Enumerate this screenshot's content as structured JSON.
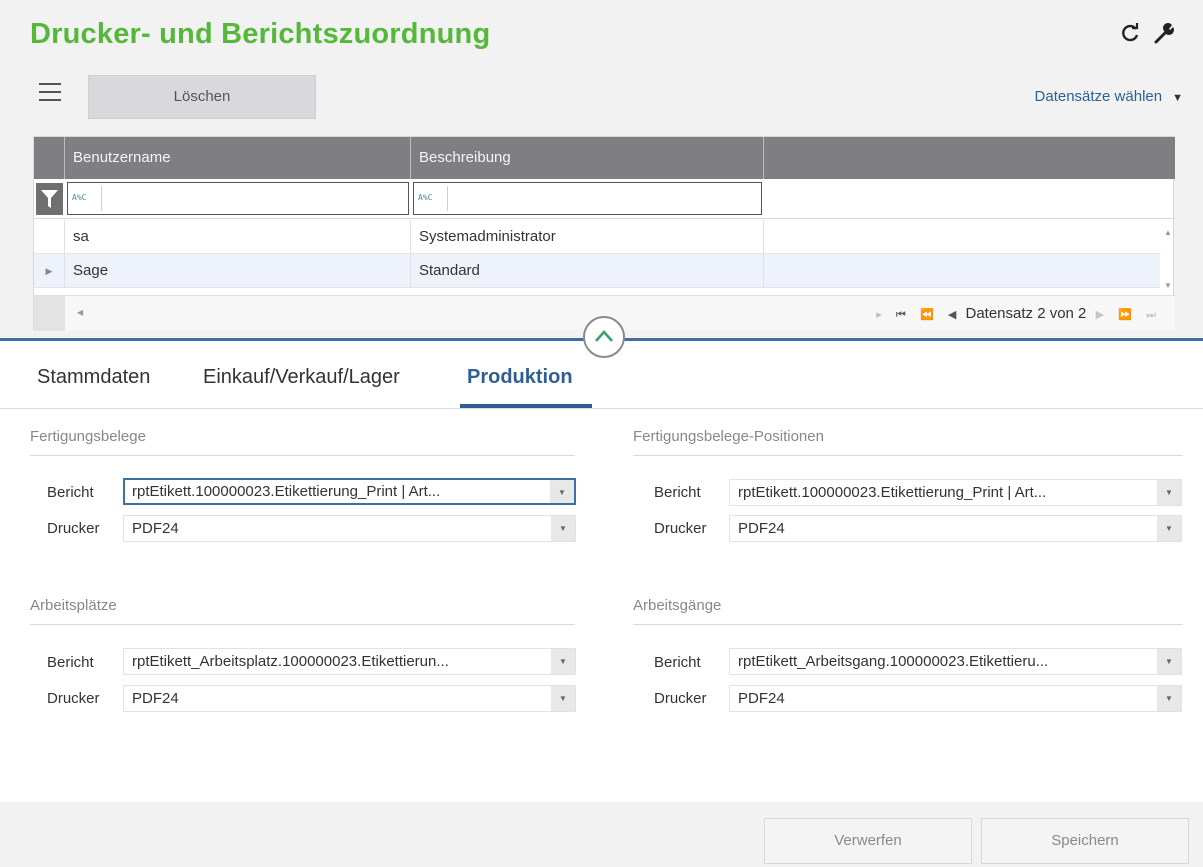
{
  "window": {
    "title": "Drucker- und Berichtszuordnung"
  },
  "toolbar": {
    "delete_label": "Löschen",
    "select_records_label": "Datensätze wählen",
    "refresh_icon": "refresh-icon",
    "settings_icon": "wrench-icon",
    "menu_icon": "hamburger-menu-icon"
  },
  "grid": {
    "columns": [
      "Benutzername",
      "Beschreibung",
      ""
    ],
    "filter_operator": "A%C",
    "rows": [
      {
        "user": "sa",
        "description": "Systemadministrator",
        "indicator": ""
      },
      {
        "user": "Sage",
        "description": "Standard",
        "indicator": "▶"
      }
    ],
    "pager_text": "Datensatz 2 von 2"
  },
  "tabs": [
    "Stammdaten",
    "Einkauf/Verkauf/Lager",
    "Produktion"
  ],
  "active_tab": "Produktion",
  "sections": {
    "fertigungsbelege": {
      "title": "Fertigungsbelege",
      "report_label": "Bericht",
      "report_value": "rptEtikett.100000023.Etikettierung_Print  |  Art...",
      "printer_label": "Drucker",
      "printer_value": "PDF24"
    },
    "fertigungsbelege_positionen": {
      "title": "Fertigungsbelege-Positionen",
      "report_label": "Bericht",
      "report_value": "rptEtikett.100000023.Etikettierung_Print  |  Art...",
      "printer_label": "Drucker",
      "printer_value": "PDF24"
    },
    "arbeitsplaetze": {
      "title": "Arbeitsplätze",
      "report_label": "Bericht",
      "report_value": "rptEtikett_Arbeitsplatz.100000023.Etikettierun...",
      "printer_label": "Drucker",
      "printer_value": "PDF24"
    },
    "arbeitsgaenge": {
      "title": "Arbeitsgänge",
      "report_label": "Bericht",
      "report_value": "rptEtikett_Arbeitsgang.100000023.Etikettieru...",
      "printer_label": "Drucker",
      "printer_value": "PDF24"
    }
  },
  "footer": {
    "discard_label": "Verwerfen",
    "save_label": "Speichern"
  },
  "colors": {
    "title_green": "#55b83a",
    "accent_blue": "#2f5e93",
    "grid_header": "#7f7f82"
  }
}
